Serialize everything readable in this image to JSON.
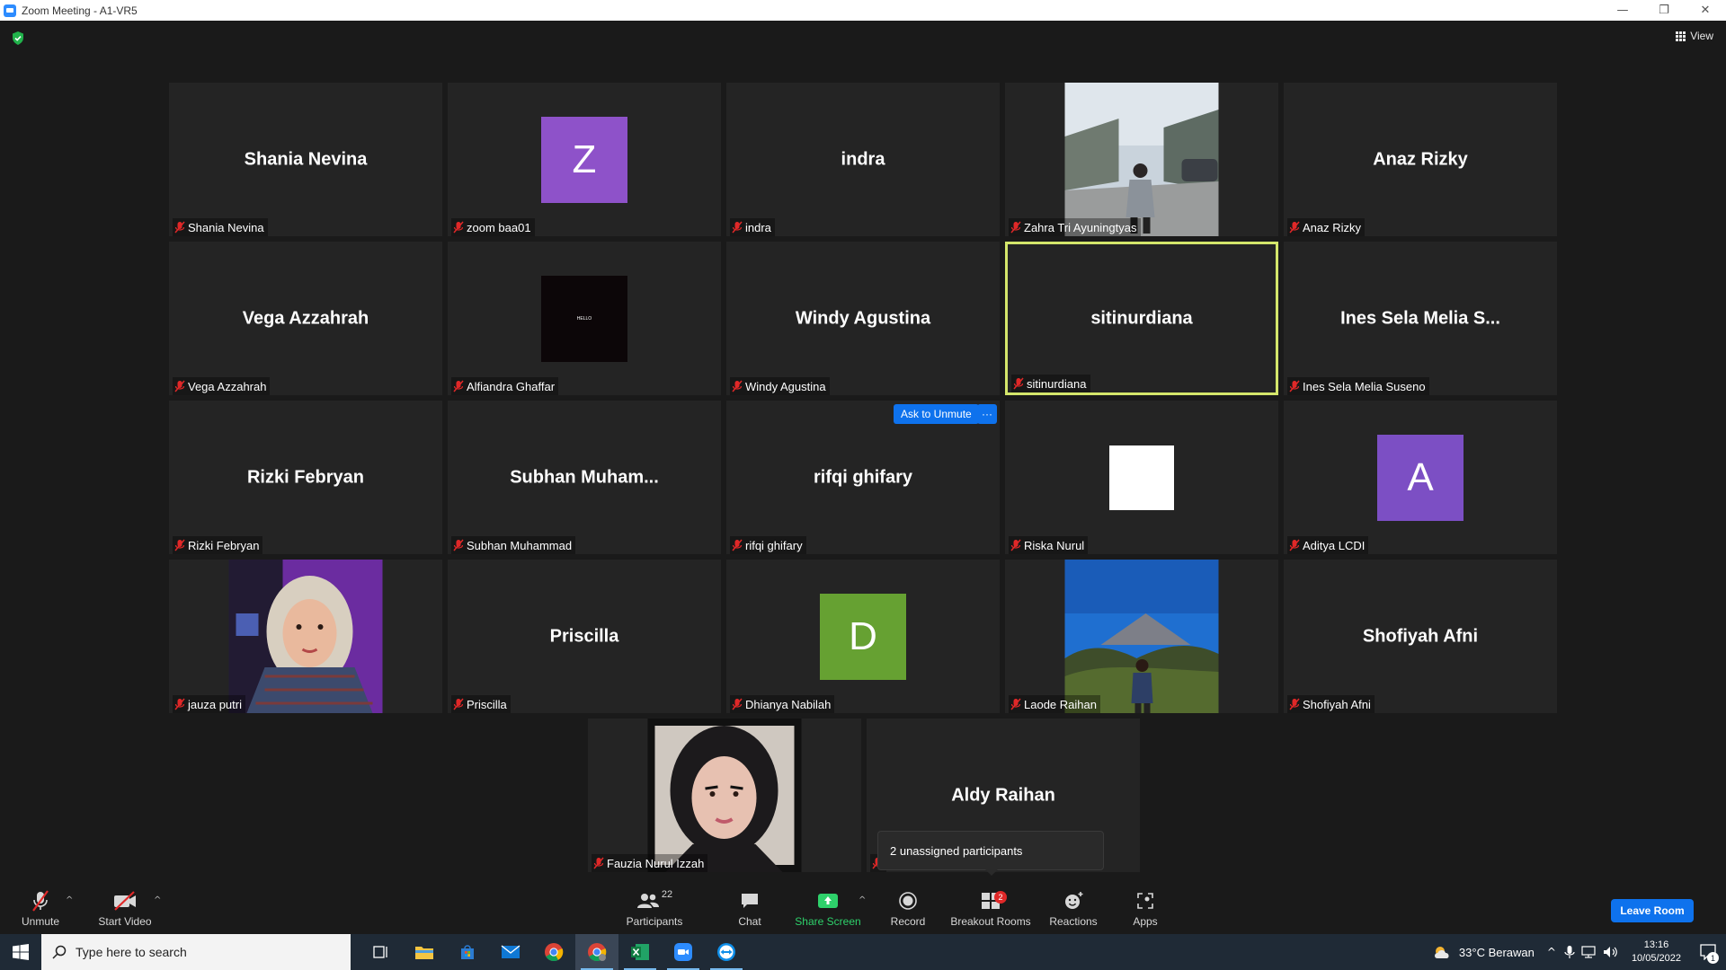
{
  "window": {
    "title": "Zoom Meeting - A1-VR5",
    "controls": [
      "minimize",
      "restore",
      "close"
    ]
  },
  "meeting": {
    "view_label": "View",
    "ask_to_unmute": "Ask to Unmute",
    "more_label": "···",
    "tooltip": "2 unassigned participants"
  },
  "tiles": [
    {
      "big": "Shania Nevina",
      "label": "Shania Nevina"
    },
    {
      "letter": "Z",
      "color": "#8e52c9",
      "label": "zoom baa01"
    },
    {
      "big": "indra",
      "label": "indra"
    },
    {
      "photo": "street",
      "label": "Zahra Tri Ayuningtyas"
    },
    {
      "big": "Anaz Rizky",
      "label": "Anaz Rizky"
    },
    {
      "big": "Vega Azzahrah",
      "label": "Vega Azzahrah"
    },
    {
      "dark_logo": "HELLO",
      "label": "Alfiandra Ghaffar"
    },
    {
      "big": "Windy Agustina",
      "label": "Windy Agustina"
    },
    {
      "big": "sitinurdiana",
      "label": "sitinurdiana",
      "active": true
    },
    {
      "big": "Ines Sela Melia S...",
      "label": "Ines Sela Melia Suseno"
    },
    {
      "big": "Rizki Febryan",
      "label": "Rizki Febryan"
    },
    {
      "big": "Subhan  Muham...",
      "label": "Subhan Muhammad"
    },
    {
      "big": "rifqi ghifary",
      "label": "rifqi ghifary"
    },
    {
      "white_square": true,
      "label": "Riska Nurul"
    },
    {
      "letter": "A",
      "color": "#7c4fc4",
      "label": "Aditya LCDI"
    },
    {
      "photo": "hijab-purple",
      "label": "jauza putri"
    },
    {
      "big": "Priscilla",
      "label": "Priscilla"
    },
    {
      "letter": "D",
      "color": "#66a132",
      "label": "Dhianya Nabilah"
    },
    {
      "photo": "mountain",
      "label": "Laode Raihan"
    },
    {
      "big": "Shofiyah Afni",
      "label": "Shofiyah Afni"
    },
    {
      "photo": "portrait",
      "label": "Fauzia Nurul Izzah"
    },
    {
      "big": "Aldy Raihan",
      "label": ""
    }
  ],
  "toolbar": {
    "unmute": "Unmute",
    "start_video": "Start Video",
    "participants": "Participants",
    "participants_count": "22",
    "chat": "Chat",
    "share_screen": "Share Screen",
    "record": "Record",
    "breakout_rooms": "Breakout Rooms",
    "breakout_badge": "2",
    "reactions": "Reactions",
    "apps": "Apps",
    "leave_room": "Leave Room"
  },
  "taskbar": {
    "search_placeholder": "Type here to search",
    "weather": "33°C  Berawan",
    "time": "13:16",
    "date": "10/05/2022",
    "notification_count": "1"
  }
}
